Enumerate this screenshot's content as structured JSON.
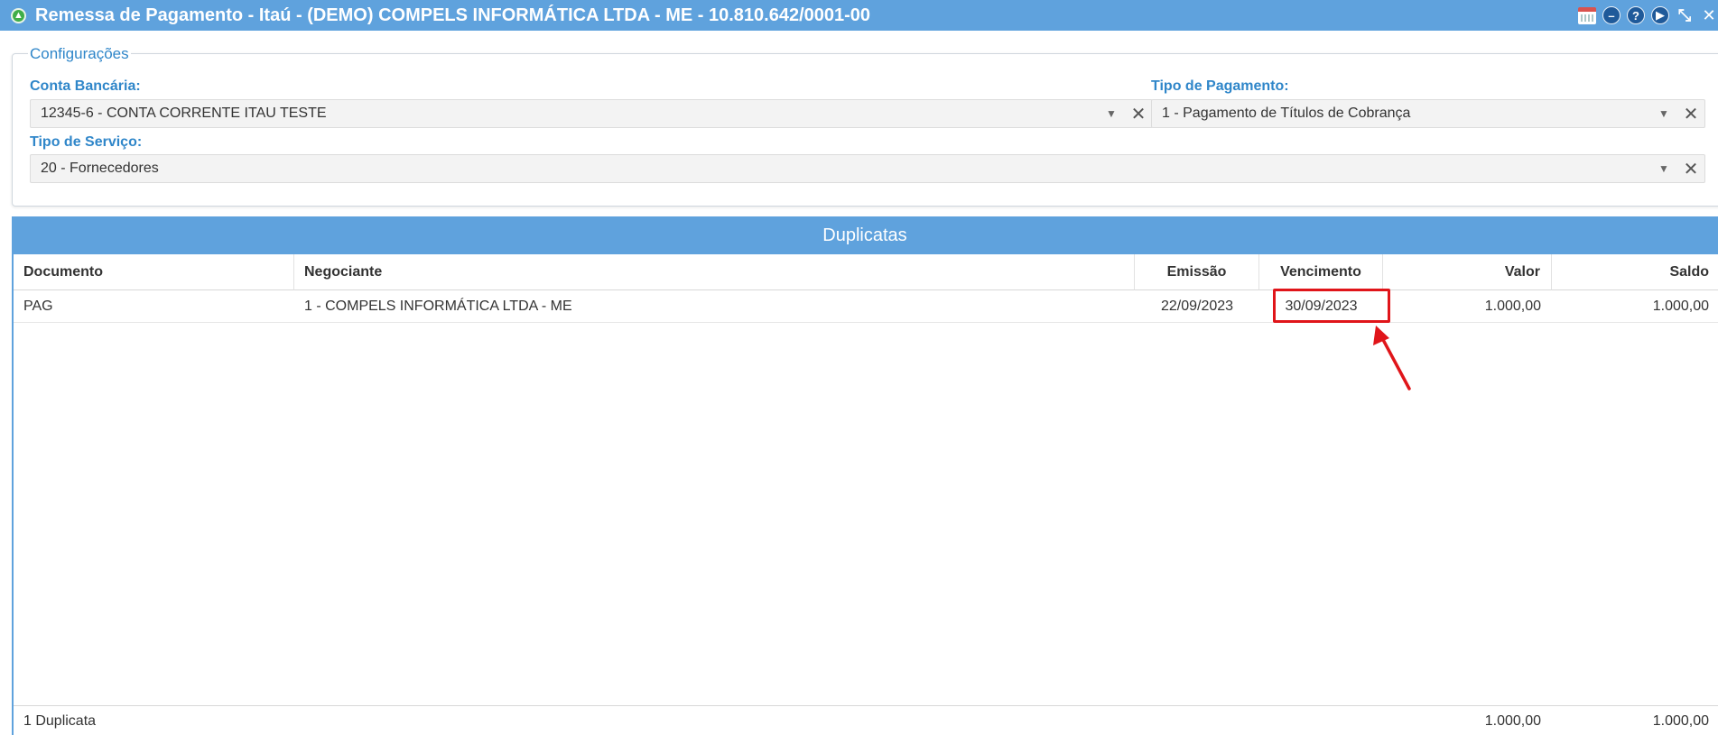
{
  "window": {
    "title": "Remessa de Pagamento - Itaú - (DEMO) COMPELS INFORMÁTICA LTDA - ME - 10.810.642/0001-00",
    "tools": [
      "calendar-icon",
      "minimize-icon",
      "help-icon",
      "play-icon",
      "collapse-icon",
      "close-icon"
    ]
  },
  "config": {
    "legend": "Configurações",
    "conta_bancaria": {
      "label": "Conta Bancária:",
      "value": "12345-6 - CONTA CORRENTE ITAU TESTE"
    },
    "tipo_pagamento": {
      "label": "Tipo de Pagamento:",
      "value": "1 - Pagamento de Títulos de Cobrança"
    },
    "tipo_servico": {
      "label": "Tipo de Serviço:",
      "value": "20 - Fornecedores"
    }
  },
  "grid": {
    "title": "Duplicatas",
    "columns": [
      "Documento",
      "Negociante",
      "Emissão",
      "Vencimento",
      "Valor",
      "Saldo"
    ],
    "rows": [
      {
        "documento": "PAG",
        "negociante": "1 - COMPELS INFORMÁTICA LTDA - ME",
        "emissao": "22/09/2023",
        "vencimento": "30/09/2023",
        "valor": "1.000,00",
        "saldo": "1.000,00"
      }
    ],
    "footer": {
      "count": "1 Duplicata",
      "valor_total": "1.000,00",
      "saldo_total": "1.000,00"
    }
  },
  "colors": {
    "accent": "#5fa2dd",
    "label": "#2f86c9",
    "highlight": "#e0151a"
  }
}
